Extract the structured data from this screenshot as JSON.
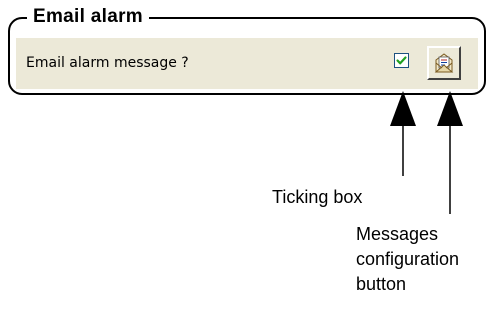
{
  "group": {
    "title": "Email alarm",
    "row_label": "Email alarm message ?",
    "checkbox_checked": true,
    "checkbox_color": "#21a121",
    "config_button_icon": "document-envelope-icon"
  },
  "annotations": {
    "ticking_box": "Ticking box",
    "config_line1": "Messages",
    "config_line2": "configuration",
    "config_line3": "button"
  },
  "colors": {
    "panel_bg": "#ece9d8",
    "frame": "#000000"
  }
}
